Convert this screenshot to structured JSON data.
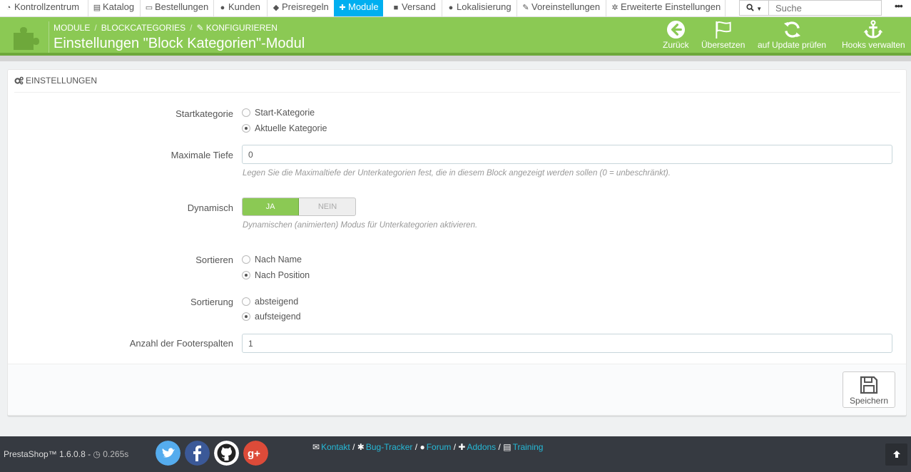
{
  "topnav": {
    "items": [
      {
        "label": "Kontrollzentrum",
        "icon": "dashboard-icon"
      },
      {
        "label": "Katalog",
        "icon": "book-icon"
      },
      {
        "label": "Bestellungen",
        "icon": "credit-card-icon"
      },
      {
        "label": "Kunden",
        "icon": "users-icon"
      },
      {
        "label": "Preisregeln",
        "icon": "tags-icon"
      },
      {
        "label": "Module",
        "icon": "puzzle-icon"
      },
      {
        "label": "Versand",
        "icon": "truck-icon"
      },
      {
        "label": "Lokalisierung",
        "icon": "globe-icon"
      },
      {
        "label": "Voreinstellungen",
        "icon": "wrench-icon"
      },
      {
        "label": "Erweiterte Einstellungen",
        "icon": "cogs-icon"
      }
    ],
    "active": "Module",
    "search_placeholder": "Suche",
    "more": "•••"
  },
  "header": {
    "breadcrumb": [
      "MODULE",
      "BLOCKCATEGORIES",
      "KONFIGURIEREN"
    ],
    "breadcrumb_separator": "/",
    "title": "Einstellungen \"Block Kategorien\"-Modul",
    "toolbar": [
      {
        "label": "Zurück",
        "icon": "arrow-left-circle-icon"
      },
      {
        "label": "Übersetzen",
        "icon": "flag-icon"
      },
      {
        "label": "auf Update prüfen",
        "icon": "refresh-icon"
      },
      {
        "label": "Hooks verwalten",
        "icon": "anchor-icon"
      }
    ],
    "color": "#8bc954"
  },
  "panel": {
    "heading": "EINSTELLUNGEN",
    "startkategorie": {
      "label": "Startkategorie",
      "options": [
        "Start-Kategorie",
        "Aktuelle Kategorie"
      ],
      "selected": "Aktuelle Kategorie"
    },
    "max_depth": {
      "label": "Maximale Tiefe",
      "value": "0",
      "help": "Legen Sie die Maximaltiefe der Unterkategorien fest, die in diesem Block angezeigt werden sollen (0 = unbeschränkt)."
    },
    "dynamic": {
      "label": "Dynamisch",
      "yes": "JA",
      "no": "NEIN",
      "value": "JA",
      "help": "Dynamischen (animierten) Modus für Unterkategorien aktivieren."
    },
    "sort": {
      "label": "Sortieren",
      "options": [
        "Nach Name",
        "Nach Position"
      ],
      "selected": "Nach Position"
    },
    "order": {
      "label": "Sortierung",
      "options": [
        "absteigend",
        "aufsteigend"
      ],
      "selected": "aufsteigend"
    },
    "footer_columns": {
      "label": "Anzahl der Footerspalten",
      "value": "1"
    },
    "save_label": "Speichern"
  },
  "footer": {
    "version": "PrestaShop™ 1.6.0.8 - ",
    "load_time": "0.265s",
    "social": [
      "twitter-icon",
      "facebook-icon",
      "github-icon",
      "google-plus-icon"
    ],
    "links": [
      "Kontakt",
      "Bug-Tracker",
      "Forum",
      "Addons",
      "Training"
    ],
    "link_separator": "/"
  }
}
